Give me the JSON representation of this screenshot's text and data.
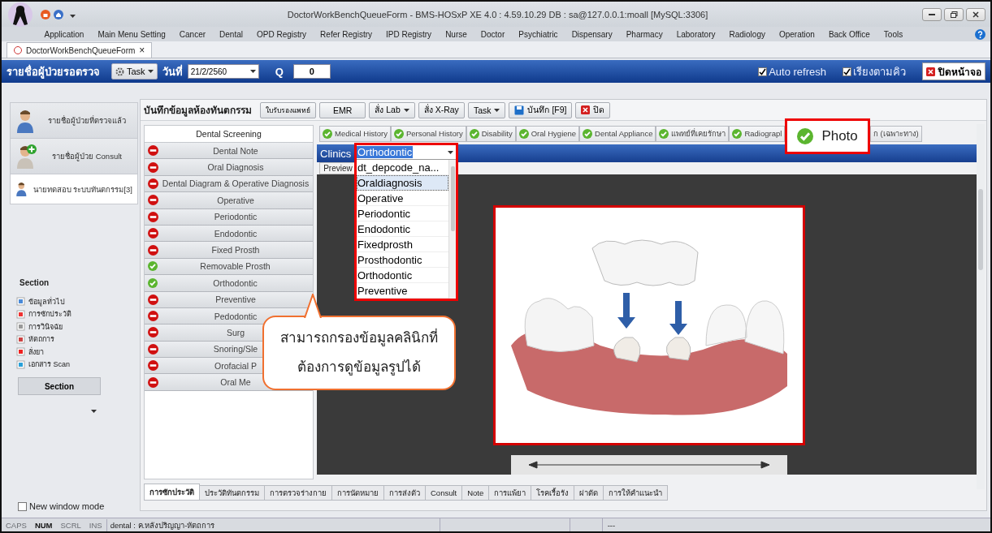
{
  "window": {
    "title": "DoctorWorkBenchQueueForm - BMS-HOSxP XE 4.0 : 4.59.10.29 DB : sa@127.0.0.1:moall [MySQL:3306]"
  },
  "menu": [
    "Application",
    "Main Menu Setting",
    "Cancer",
    "Dental",
    "OPD Registry",
    "Refer Registry",
    "IPD Registry",
    "Nurse",
    "Doctor",
    "Psychiatric",
    "Dispensary",
    "Pharmacy",
    "Laboratory",
    "Radiology",
    "Operation",
    "Back Office",
    "Tools"
  ],
  "document_tabs": [
    {
      "label": "DoctorWorkBenchQueueForm",
      "close": "×",
      "selected": true
    }
  ],
  "queue_toolbar": {
    "title": "รายชื่อผู้ป่วยรอตรวจ",
    "task_button": "Task",
    "date_label": "วันที่",
    "date_value": "21/2/2560",
    "q_label": "Q",
    "q_value": "0",
    "options": [
      {
        "label": "Auto refresh",
        "checked": true
      },
      {
        "label": "เรียงตามคิว",
        "checked": true
      }
    ],
    "close_button": "ปิดหน้าจอ"
  },
  "sidebar": {
    "patient_lists": [
      {
        "label": "รายชื่อผู้ป่วยที่ตรวจแล้ว",
        "selected": false
      },
      {
        "label": "รายชื่อผู้ป่วย Consult",
        "selected": false
      },
      {
        "label": "นายทดสอบ ระบบทันตกรรม[3]",
        "selected": true
      }
    ],
    "section_title": "Section",
    "sections": [
      "ข้อมูลทั่วไป",
      "การซักประวัติ",
      "การวินิจฉัย",
      "หัตถการ",
      "สั่งยา",
      "เอกสาร Scan"
    ],
    "section_button": "Section",
    "new_window_mode": {
      "label": "New window mode",
      "checked": false
    }
  },
  "form": {
    "title": "บันทึกข้อมูลห้องทันตกรรม",
    "buttons": [
      {
        "label": "ใบรับรองแพทย์",
        "kind": "plain"
      },
      {
        "label": "EMR",
        "kind": "plain"
      },
      {
        "label": "สั่ง Lab",
        "kind": "dropdown"
      },
      {
        "label": "สั่ง X-Ray",
        "kind": "plain"
      },
      {
        "label": "Task",
        "kind": "dropdown"
      },
      {
        "label": "บันทึก [F9]",
        "kind": "save"
      },
      {
        "label": "ปิด",
        "kind": "close"
      }
    ],
    "screening": {
      "header": "Dental Screening",
      "items": [
        {
          "label": "Dental Note",
          "done": false
        },
        {
          "label": "Oral Diagnosis",
          "done": false
        },
        {
          "label": "Dental Diagram & Operative Diagnosis",
          "done": false
        },
        {
          "label": "Operative",
          "done": false
        },
        {
          "label": "Periodontic",
          "done": false
        },
        {
          "label": "Endodontic",
          "done": false
        },
        {
          "label": "Fixed Prosth",
          "done": false
        },
        {
          "label": "Removable Prosth",
          "done": true
        },
        {
          "label": "Orthodontic",
          "done": true
        },
        {
          "label": "Preventive",
          "done": false
        },
        {
          "label": "Pedodontic",
          "done": false
        },
        {
          "label": "Surg",
          "done": false
        },
        {
          "label": "Snoring/Sle",
          "done": false
        },
        {
          "label": "Orofacial P",
          "done": false
        },
        {
          "label": "Oral Me",
          "done": false
        }
      ]
    },
    "tabs": [
      {
        "label": "Medical History",
        "done": true,
        "selected": false
      },
      {
        "label": "Personal History",
        "done": true,
        "selected": false
      },
      {
        "label": "Disability",
        "done": true,
        "selected": false
      },
      {
        "label": "Oral Hygiene",
        "done": true,
        "selected": false
      },
      {
        "label": "Dental Appliance",
        "done": true,
        "selected": false
      },
      {
        "label": "แพทย์ที่เคยรักษา",
        "done": true,
        "selected": false
      },
      {
        "label": "Radiograpl",
        "done": true,
        "selected": false
      },
      {
        "label": "Photo",
        "done": true,
        "selected": true
      },
      {
        "label": "ก (เฉพาะทาง)",
        "done": false,
        "selected": false
      }
    ],
    "clinics": {
      "label": "Clinics",
      "value": "Orthodontic",
      "options": [
        {
          "label": "dt_depcode_na...",
          "highlighted": false
        },
        {
          "label": "Oraldiagnosis",
          "highlighted": true
        },
        {
          "label": "Operative",
          "highlighted": false
        },
        {
          "label": "Periodontic",
          "highlighted": false
        },
        {
          "label": "Endodontic",
          "highlighted": false
        },
        {
          "label": "Fixedprosth",
          "highlighted": false
        },
        {
          "label": "Prosthodontic",
          "highlighted": false
        },
        {
          "label": "Orthodontic",
          "highlighted": false
        },
        {
          "label": "Preventive",
          "highlighted": false
        }
      ]
    },
    "preview_tab": "Preview",
    "callout": "สามารถกรองข้อมูลคลินิกที่ต้องการดูข้อมูลรูปได้",
    "bottom_tabs": [
      {
        "label": "การซักประวัติ",
        "selected": true
      },
      {
        "label": "ประวัติทันตกรรม",
        "selected": false
      },
      {
        "label": "การตรวจร่างกาย",
        "selected": false
      },
      {
        "label": "การนัดหมาย",
        "selected": false
      },
      {
        "label": "การส่งตัว",
        "selected": false
      },
      {
        "label": "Consult",
        "selected": false
      },
      {
        "label": "Note",
        "selected": false
      },
      {
        "label": "การแพ้ยา",
        "selected": false
      },
      {
        "label": "โรคเรื้อรัง",
        "selected": false
      },
      {
        "label": "ผ่าตัด",
        "selected": false
      },
      {
        "label": "การให้คำแนะนำ",
        "selected": false
      }
    ]
  },
  "status_bar": {
    "indicators": [
      {
        "label": "CAPS",
        "on": false
      },
      {
        "label": "NUM",
        "on": true
      },
      {
        "label": "SCRL",
        "on": false
      },
      {
        "label": "INS",
        "on": false
      }
    ],
    "text": "dental : ค.หลังปริญญา-หัตถการ",
    "right": "---"
  }
}
